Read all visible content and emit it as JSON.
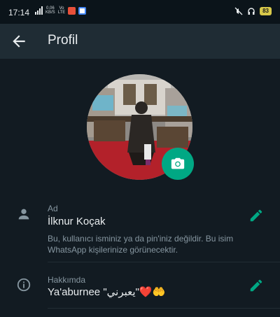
{
  "status_bar": {
    "time": "17:14",
    "net_speed": "0.06",
    "net_unit": "KB/S",
    "volte_1": "Vo",
    "volte_2": "LTE",
    "battery": "83"
  },
  "app_bar": {
    "title": "Profil",
    "back_icon": "arrow-back-icon"
  },
  "profile": {
    "camera_icon": "camera-icon",
    "name": {
      "label": "Ad",
      "value": "İlknur Koçak",
      "hint": "Bu, kullanıcı isminiz ya da pin'iniz değildir. Bu isim WhatsApp kişilerinize görünecektir."
    },
    "about": {
      "label": "Hakkımda",
      "value": "Ya'aburnee \"يعبرني\"❤️🤲"
    }
  },
  "colors": {
    "accent": "#00a884",
    "background": "#121b22",
    "appbar": "#1f2c34"
  }
}
